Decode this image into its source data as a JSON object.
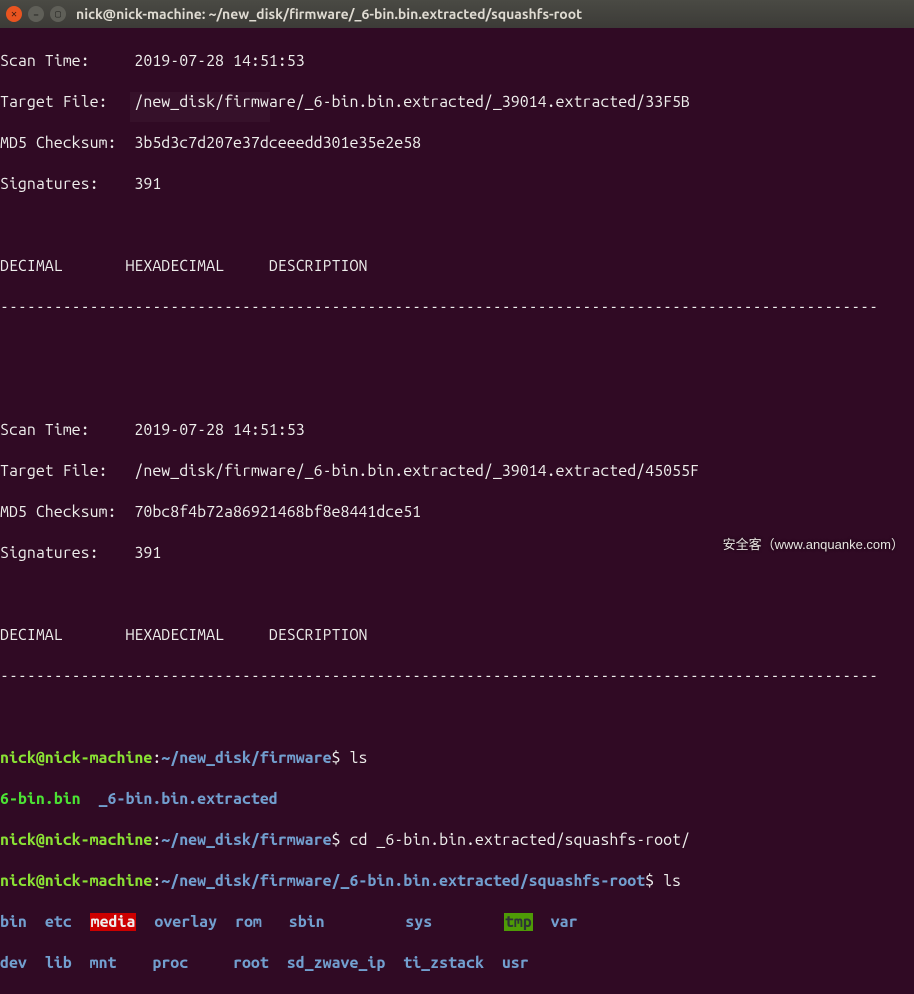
{
  "window": {
    "title": "nick@nick-machine: ~/new_disk/firmware/_6-bin.bin.extracted/squashfs-root"
  },
  "dash_row": "--------------------------------------------------------------------------------------------------",
  "scan1": {
    "time_label": "Scan Time:",
    "time_value": "2019-07-28 14:51:53",
    "file_label": "Target File:",
    "file_value": "/new_disk/firmware/_6-bin.bin.extracted/_39014.extracted/33F5B",
    "md5_label": "MD5 Checksum:",
    "md5_value": "3b5d3c7d207e37dceeedd301e35e2e58",
    "sig_label": "Signatures:",
    "sig_value": "391",
    "hdr_dec": "DECIMAL",
    "hdr_hex": "HEXADECIMAL",
    "hdr_desc": "DESCRIPTION"
  },
  "scan2": {
    "time_label": "Scan Time:",
    "time_value": "2019-07-28 14:51:53",
    "file_label": "Target File:",
    "file_value": "/new_disk/firmware/_6-bin.bin.extracted/_39014.extracted/45055F",
    "md5_label": "MD5 Checksum:",
    "md5_value": "70bc8f4b72a86921468bf8e8441dce51",
    "sig_label": "Signatures:",
    "sig_value": "391",
    "hdr_dec": "DECIMAL",
    "hdr_hex": "HEXADECIMAL",
    "hdr_desc": "DESCRIPTION"
  },
  "prompt1": {
    "userhost": "nick@nick-machine",
    "path": "~/new_disk/firmware",
    "dollar": "$",
    "cmd": "ls"
  },
  "ls1": {
    "item_green": "6-bin.bin",
    "item_blue": "_6-bin.bin.extracted"
  },
  "prompt2": {
    "userhost": "nick@nick-machine",
    "path": "~/new_disk/firmware",
    "dollar": "$",
    "cmd": "cd _6-bin.bin.extracted/squashfs-root/"
  },
  "prompt3": {
    "userhost": "nick@nick-machine",
    "path": "~/new_disk/firmware/_6-bin.bin.extracted/squashfs-root",
    "dollar": "$",
    "cmd": "ls"
  },
  "ls2": {
    "row1": {
      "bin": "bin",
      "etc": "etc",
      "media": "media",
      "overlay": "overlay",
      "rom": "rom",
      "sbin": "sbin",
      "sys": "sys",
      "tmp": "tmp",
      "var": "var"
    },
    "row2": {
      "dev": "dev",
      "lib": "lib",
      "mnt": "mnt",
      "proc": "proc",
      "root": "root",
      "sd_zwave_ip": "sd_zwave_ip",
      "ti_zstack": "ti_zstack",
      "usr": "usr"
    }
  },
  "watermark": "安全客（www.anquanke.com）"
}
